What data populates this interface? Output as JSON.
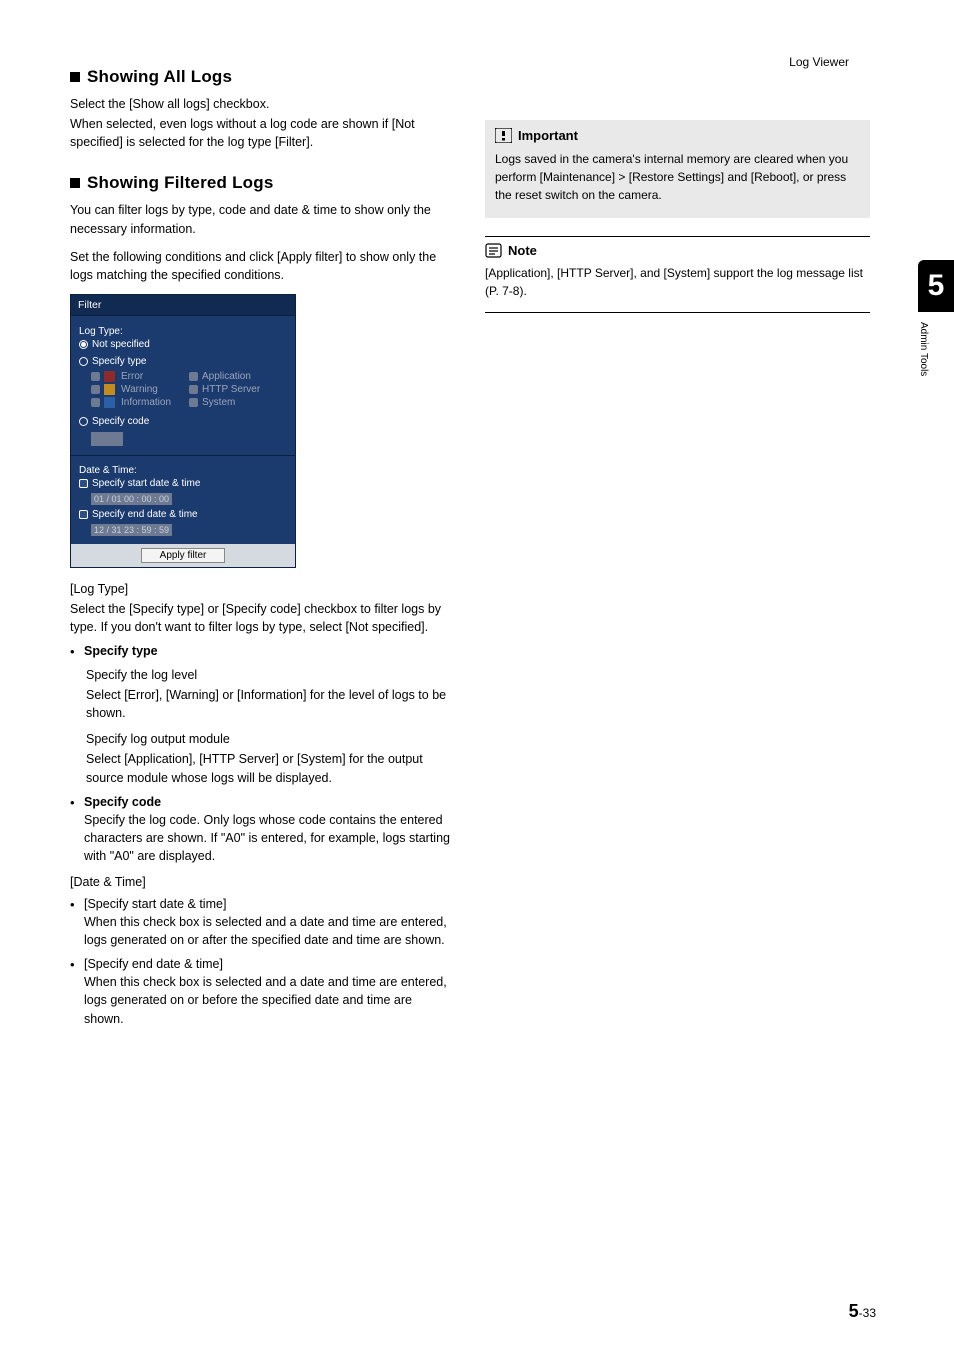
{
  "header": {
    "section_name": "Log Viewer"
  },
  "left": {
    "h_all": "Showing All Logs",
    "p_all_1": "Select the [Show all logs] checkbox.",
    "p_all_2": "When selected, even logs without a log code are shown if [Not specified] is selected for the log type [Filter].",
    "h_filtered": "Showing Filtered Logs",
    "p_filt_1": "You can filter logs by type, code and date & time to show only the necessary information.",
    "p_filt_2": "Set the following conditions and click [Apply filter] to show only the logs matching the specified conditions.",
    "panel": {
      "title": "Filter",
      "log_type_label": "Log Type:",
      "opt_not_specified": "Not specified",
      "opt_specify_type": "Specify type",
      "lvl_error": "Error",
      "lvl_warning": "Warning",
      "lvl_information": "Information",
      "mod_app": "Application",
      "mod_http": "HTTP Server",
      "mod_sys": "System",
      "opt_specify_code": "Specify code",
      "dt_label": "Date & Time:",
      "dt_start": "Specify start date & time",
      "dt_start_val": "01 / 01 00 : 00 : 00",
      "dt_end": "Specify end date & time",
      "dt_end_val": "12 / 31 23 : 59 : 59",
      "apply": "Apply filter"
    },
    "log_type_head": "[Log Type]",
    "log_type_body": "Select the [Specify type] or [Specify code] checkbox to filter logs by type. If you don't want to filter logs by type, select [Not specified].",
    "b_spec_type": "Specify type",
    "spec_lvl_head": "Specify the log level",
    "spec_lvl_body": "Select [Error], [Warning] or [Information] for the level of logs to be shown.",
    "spec_mod_head": "Specify log output module",
    "spec_mod_body": "Select [Application], [HTTP Server] or [System] for the output source module whose logs will be displayed.",
    "b_spec_code": "Specify code",
    "spec_code_body": "Specify the log code. Only logs whose code contains the entered characters are shown. If \"A0\" is entered, for example, logs starting with \"A0\" are displayed.",
    "dt_head": "[Date & Time]",
    "b_dt_start": "[Specify start date & time]",
    "dt_start_body": "When this check box is selected and a date and time are entered, logs generated on or after the specified date and time are shown.",
    "b_dt_end": "[Specify end date & time]",
    "dt_end_body": "When this check box is selected and a date and time are entered, logs generated on or before the specified date and time are shown."
  },
  "right": {
    "important_title": "Important",
    "important_body": "Logs saved in the camera's internal memory are cleared when you perform [Maintenance] > [Restore Settings] and [Reboot], or press the reset switch on the camera.",
    "note_title": "Note",
    "note_body": "[Application], [HTTP Server], and [System] support the log message list (P. 7-8)."
  },
  "side": {
    "chapter": "5",
    "label": "Admin Tools"
  },
  "footer": {
    "chapter": "5",
    "page": "-33"
  }
}
